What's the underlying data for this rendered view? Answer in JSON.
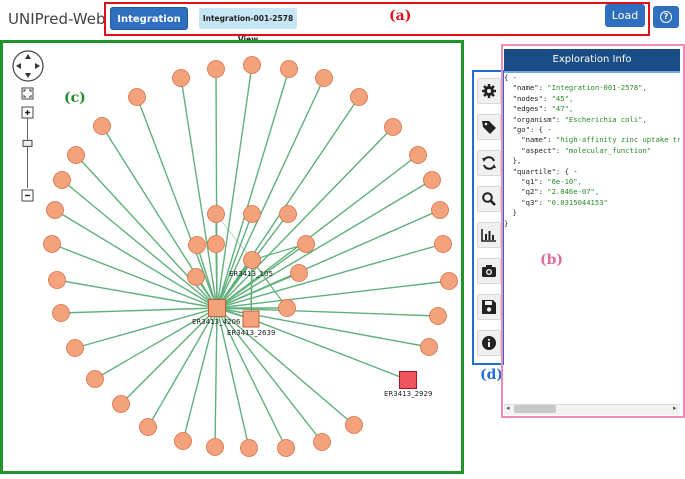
{
  "app": {
    "title": "UNIPred-Web"
  },
  "nav": {
    "integration_button": "Integration",
    "view_tab": "Integration-001-2578 View",
    "load_button": "Load",
    "help_icon": "help-circle-icon",
    "section_label": "(a)"
  },
  "graph": {
    "section_label": "(c)",
    "node_labels": [
      "ER3413_105",
      "ER3413_4206",
      "ER3413_2639",
      "ER3413_2929"
    ],
    "colors": {
      "node": "#f4a27c",
      "node_stroke": "#d4704a",
      "edge": "#5fb07a",
      "highlight_node": "#f0545c"
    },
    "controls": {
      "pan": "pan-arrows-icon",
      "fit": "fit-screen-icon",
      "zoom_in": "plus-icon",
      "zoom_out": "minus-icon",
      "zoom_slider_level": 0.35
    }
  },
  "toolbar": {
    "section_label": "(d)",
    "tools": [
      "gear-icon",
      "tag-icon",
      "refresh-icon",
      "search-icon",
      "bar-chart-icon",
      "camera-icon",
      "save-icon",
      "info-icon"
    ]
  },
  "info": {
    "section_label": "(b)",
    "header": "Exploration Info",
    "lines": [
      "{ -",
      "  \"name\": \"Integration-001-2578\",",
      "  \"nodes\": \"45\",",
      "  \"edges\": \"47\",",
      "  \"organism\": \"Escherichia coli\",",
      "  \"go\": { -",
      "    \"name\": \"high-affinity zinc uptake tr",
      "    \"aspect\": \"molecular_function\"",
      "  },",
      "  \"quartile\": { -",
      "    \"q1\": \"6e-10\",",
      "    \"q2\": \"2.846e-07\",",
      "    \"q3\": \"0.0315044153\"",
      "  }",
      "}"
    ]
  }
}
